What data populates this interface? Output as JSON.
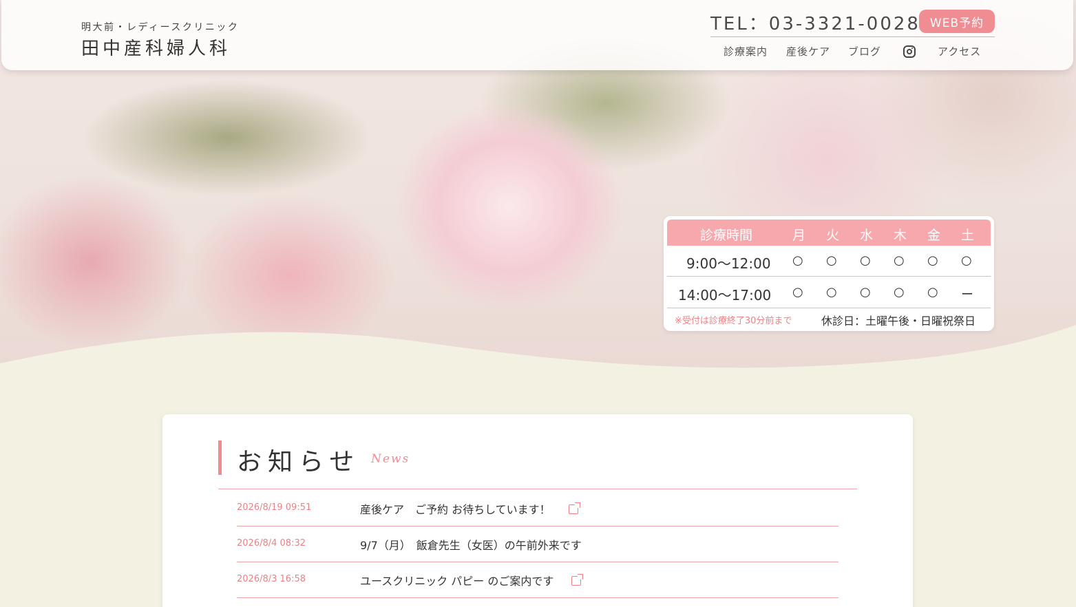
{
  "header": {
    "logo_sub": "明大前・レディースクリニック",
    "logo_main": "田中産科婦人科",
    "tel": "TEL：03-3321-0028",
    "web_reservation": "WEB予約",
    "nav": [
      "診療案内",
      "産後ケア",
      "ブログ",
      "アクセス"
    ],
    "instagram_icon": "instagram-icon"
  },
  "hours": {
    "header": [
      "診療時間",
      "月",
      "火",
      "水",
      "木",
      "金",
      "土"
    ],
    "rows": [
      {
        "time": "9:00〜12:00",
        "marks": [
          "○",
          "○",
          "○",
          "○",
          "○",
          "○"
        ]
      },
      {
        "time": "14:00〜17:00",
        "marks": [
          "○",
          "○",
          "○",
          "○",
          "○",
          "ー"
        ]
      }
    ],
    "note": "※受付は診療終了30分前まで",
    "closed": "休診日：土曜午後・日曜祝祭日"
  },
  "news": {
    "title": "お知らせ",
    "title_en": "News",
    "items": [
      {
        "date": "2026/8/19 09:51",
        "text": "産後ケア　ご予約 お待ちしています！",
        "external": true
      },
      {
        "date": "2026/8/4 08:32",
        "text": "9/7（月）　飯倉先生（女医）の午前外来です",
        "external": false
      },
      {
        "date": "2026/8/3 16:58",
        "text": "ユースクリニック パピー のご案内です",
        "external": true
      }
    ]
  },
  "colors": {
    "accent": "#ef8d92",
    "table_header": "#f6a8ad",
    "background": "#f3f1e2"
  }
}
